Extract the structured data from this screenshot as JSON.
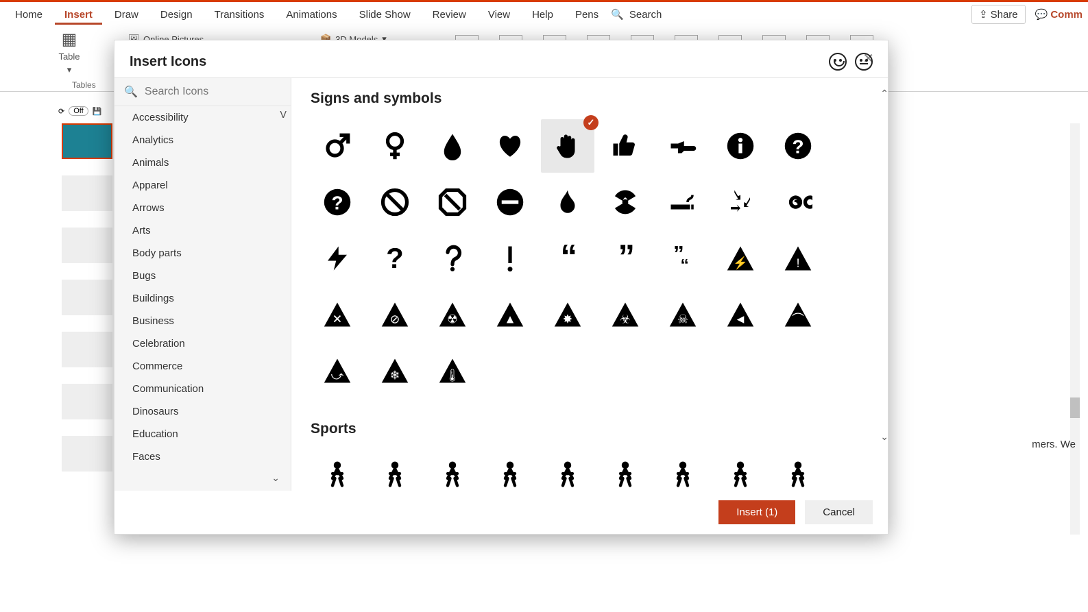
{
  "ribbon": {
    "tabs": [
      "Home",
      "Insert",
      "Draw",
      "Design",
      "Transitions",
      "Animations",
      "Slide Show",
      "Review",
      "View",
      "Help",
      "Pens"
    ],
    "active_tab": "Insert",
    "search_label": "Search",
    "share_label": "Share",
    "comments_label": "Comm",
    "insert_group": {
      "table_label": "Table",
      "tables_section": "Tables",
      "online_pictures": "Online Pictures",
      "models_label": "3D Models"
    },
    "qat_off": "Off"
  },
  "dialog": {
    "title": "Insert Icons",
    "search_placeholder": "Search Icons",
    "categories": [
      "Accessibility",
      "Analytics",
      "Animals",
      "Apparel",
      "Arrows",
      "Arts",
      "Body parts",
      "Bugs",
      "Buildings",
      "Business",
      "Celebration",
      "Commerce",
      "Communication",
      "Dinosaurs",
      "Education",
      "Faces"
    ],
    "section1_title": "Signs and symbols",
    "section2_title": "Sports",
    "icons_row1": [
      "male-symbol",
      "female-symbol",
      "drop",
      "heart",
      "hand-stop",
      "thumbs-up",
      "point-right",
      "info-circle",
      "question-circle"
    ],
    "icons_row2": [
      "question-filled",
      "no-entry",
      "no-entry-octagon",
      "minus-circle",
      "flame",
      "radiation",
      "smoking",
      "recycle",
      "infinity"
    ],
    "icons_row3": [
      "bolt",
      "question-mark",
      "question-hook",
      "exclamation",
      "quote-open",
      "quote-close",
      "quote-smart",
      "warn-voltage",
      "warn-exclaim"
    ],
    "icons_row4": [
      "tri-x",
      "tri-nosmoking",
      "tri-radiation",
      "tri-fire",
      "tri-explosion",
      "tri-biohazard",
      "tri-skull",
      "tri-camera",
      "tri-bump"
    ],
    "icons_row5": [
      "tri-slip",
      "tri-frost",
      "tri-temp"
    ],
    "sports_row": [
      "baseball",
      "running",
      "soccer",
      "tennis",
      "cycling",
      "skiing",
      "swimming",
      "golfing",
      "hiking"
    ],
    "selected_icon": "hand-stop",
    "insert_button": "Insert (1)",
    "cancel_button": "Cancel"
  },
  "behind_text": "mers. We"
}
